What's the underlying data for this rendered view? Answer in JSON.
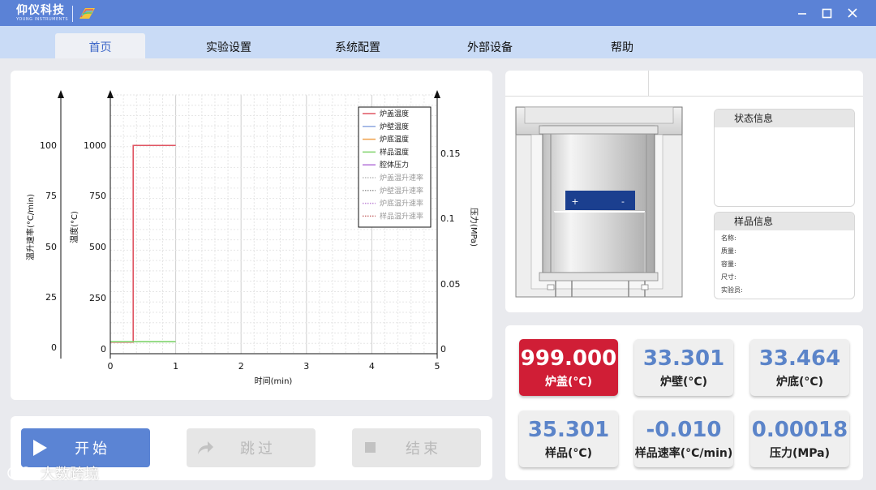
{
  "app": {
    "logo_text": "仰仪科技",
    "logo_sub": "YOUNG INSTRUMENTS"
  },
  "tabs": [
    "首页",
    "实验设置",
    "系统配置",
    "外部设备",
    "帮助"
  ],
  "controls": {
    "start": "开始",
    "skip": "跳过",
    "end": "结束"
  },
  "status_panel": {
    "title": "状态信息"
  },
  "sample_panel": {
    "title": "样品信息",
    "fields": [
      "名称:",
      "质量:",
      "容量:",
      "尺寸:",
      "实验员:"
    ]
  },
  "device": {
    "plus": "+",
    "minus": "-"
  },
  "readouts": [
    {
      "value": "999.000",
      "label": "炉盖(°C)",
      "alarm": true
    },
    {
      "value": "33.301",
      "label": "炉壁(°C)"
    },
    {
      "value": "33.464",
      "label": "炉底(°C)"
    },
    {
      "value": "35.301",
      "label": "样品(°C)"
    },
    {
      "value": "-0.010",
      "label": "样品速率(°C/min)"
    },
    {
      "value": "0.00018",
      "label": "压力(MPa)"
    }
  ],
  "watermark": "大数跨境",
  "colors": {
    "titlebar": "#5b82d6",
    "tabbar": "#c9dbf6",
    "active_tab_text": "#3d67c8",
    "start_button": "#5b84d4",
    "disabled_button": "#e6e6e6",
    "readout_value": "#5b84c9",
    "alarm": "#d01e36",
    "device_blue": "#1b3f8f"
  },
  "chart_data": {
    "type": "line",
    "xlabel": "时间(min)",
    "xlim": [
      0,
      5
    ],
    "x_ticks": [
      0,
      1,
      2,
      3,
      4,
      5
    ],
    "y_axes": [
      {
        "label": "温升速率(°C/min)",
        "ticks": [
          0,
          25,
          50,
          75,
          100
        ]
      },
      {
        "label": "温度(°C)",
        "ticks": [
          0,
          250,
          500,
          750,
          1000
        ]
      },
      {
        "label": "压力(MPa)",
        "ticks": [
          0,
          0.05,
          0.1,
          0.15
        ]
      }
    ],
    "tick_labels": {
      "rate": [
        "0",
        "25",
        "50",
        "75",
        "100"
      ],
      "temp": [
        "0",
        "250",
        "500",
        "750",
        "1000"
      ],
      "pressure": [
        "0",
        "0.05",
        "0.1",
        "0.15"
      ],
      "time": [
        "0",
        "1",
        "2",
        "3",
        "4",
        "5"
      ]
    },
    "grid": true,
    "legend_position": "top-right",
    "series": [
      {
        "name": "炉盖温度",
        "color": "#e05563",
        "style": "solid",
        "x": [
          0,
          0.35,
          0.35,
          0.4,
          1.0
        ],
        "y": [
          33,
          33,
          999,
          999,
          999
        ]
      },
      {
        "name": "炉壁温度",
        "color": "#8fa7e0",
        "style": "solid",
        "x": [],
        "y": []
      },
      {
        "name": "炉底温度",
        "color": "#f0a24b",
        "style": "solid",
        "x": [],
        "y": []
      },
      {
        "name": "样品温度",
        "color": "#7ed36b",
        "style": "solid",
        "x": [
          0,
          1.0
        ],
        "y": [
          35,
          35
        ]
      },
      {
        "name": "腔体压力",
        "color": "#b573d9",
        "style": "solid",
        "x": [],
        "y": []
      },
      {
        "name": "炉盖温升速率",
        "color": "#bbbbbb",
        "style": "dotted",
        "x": [],
        "y": []
      },
      {
        "name": "炉壁温升速率",
        "color": "#999999",
        "style": "dotted",
        "x": [],
        "y": []
      },
      {
        "name": "炉底温升速率",
        "color": "#c18ad8",
        "style": "dotted",
        "x": [],
        "y": []
      },
      {
        "name": "样品温升速率",
        "color": "#c87070",
        "style": "dotted",
        "x": [],
        "y": []
      }
    ]
  }
}
